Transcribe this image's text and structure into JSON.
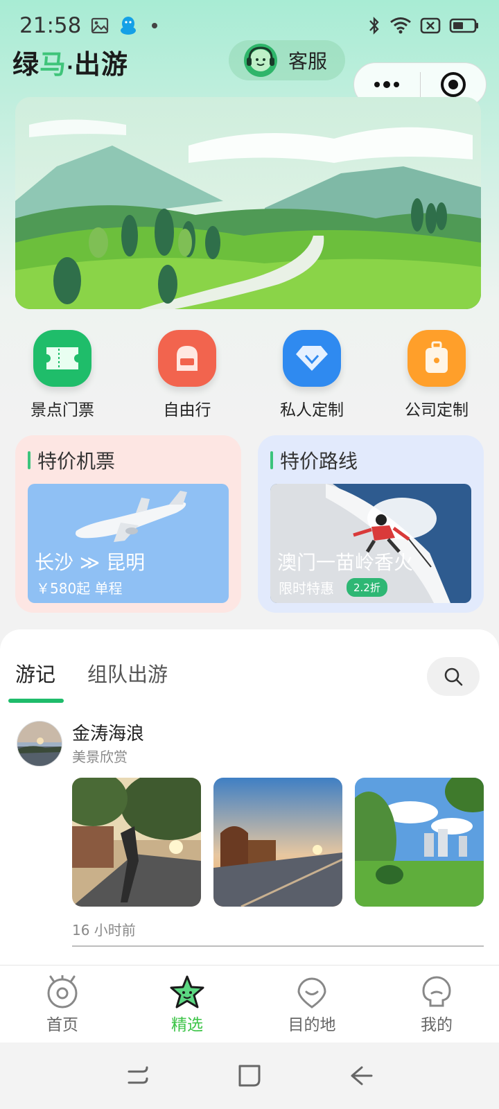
{
  "status_bar": {
    "time": "21:58",
    "left_icons": [
      "image-icon",
      "qq-icon",
      "dot-icon"
    ],
    "right_icons": [
      "bluetooth-icon",
      "wifi-icon",
      "sim-x-icon",
      "battery-icon"
    ]
  },
  "header": {
    "logo_part1": "绿",
    "logo_part2": "马",
    "logo_dot": "·",
    "logo_part3": "出游",
    "customer_service_label": "客服"
  },
  "quick_nav": [
    {
      "label": "景点门票",
      "icon": "ticket-icon",
      "color": "#1fbd6a"
    },
    {
      "label": "自由行",
      "icon": "backpack-icon",
      "color": "#f2644e"
    },
    {
      "label": "私人定制",
      "icon": "diamond-icon",
      "color": "#2f8af0"
    },
    {
      "label": "公司定制",
      "icon": "suitcase-icon",
      "color": "#ff9f2a"
    }
  ],
  "promos": {
    "flights": {
      "title": "特价机票",
      "route": "长沙 ≫ 昆明",
      "price_text": "￥580起 单程"
    },
    "routes": {
      "title": "特价路线",
      "route": "澳门一苗岭香火",
      "sub_text": "限时特惠",
      "discount": "2.2折"
    }
  },
  "feed_tabs": {
    "active": "游记",
    "inactive": "组队出游"
  },
  "post": {
    "author": "金涛海浪",
    "subtitle": "美景欣赏",
    "time": "16 小时前"
  },
  "tabbar": {
    "items": [
      {
        "label": "首页",
        "icon": "home-eye-icon",
        "active": false
      },
      {
        "label": "精选",
        "icon": "star-icon",
        "active": true
      },
      {
        "label": "目的地",
        "icon": "destination-icon",
        "active": false
      },
      {
        "label": "我的",
        "icon": "profile-icon",
        "active": false
      }
    ],
    "active_color": "#3cc447"
  }
}
